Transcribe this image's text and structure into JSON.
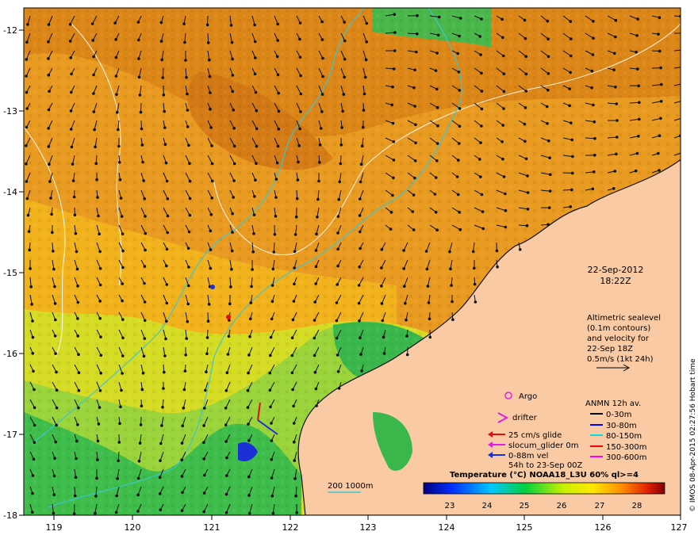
{
  "map": {
    "lon_ticks": [
      "119",
      "120",
      "121",
      "122",
      "123",
      "124",
      "125",
      "126",
      "127"
    ],
    "lat_ticks": [
      "-12",
      "-13",
      "-14",
      "-15",
      "-16",
      "-17",
      "-18"
    ],
    "lon_range": [
      118.6,
      127.0
    ],
    "lat_range": [
      -18.0,
      -11.7
    ]
  },
  "datetime": {
    "date": "22-Sep-2012",
    "time": "18:22Z"
  },
  "altimetry_note": [
    "Altimetric sealevel",
    "(0.1m contours)",
    "and velocity for",
    "22-Sep 18Z",
    "0.5m/s (1kt 24h)"
  ],
  "legend": {
    "argo": "Argo",
    "drifter": "drifter",
    "glider_speed": "25 cm/s glide",
    "slocum_glider": "slocum_glider 0m",
    "vel_line1": "0-88m vel",
    "vel_line2": "54h to 23-Sep 00Z",
    "anmn_title": "ANMN 12h av.",
    "anmn_depths": [
      {
        "label": "0-30m",
        "color": "#000000"
      },
      {
        "label": "30-80m",
        "color": "#0000ff"
      },
      {
        "label": "80-150m",
        "color": "#00e0e0"
      },
      {
        "label": "150-300m",
        "color": "#ff0000"
      },
      {
        "label": "300-600m",
        "color": "#ff00ff"
      }
    ]
  },
  "colorbar": {
    "title": "Temperature (°C) NOAA18_L3U 60% ql>=4",
    "ticks": [
      "23",
      "24",
      "25",
      "26",
      "27",
      "28"
    ],
    "range": [
      22.3,
      28.8
    ]
  },
  "isobath_label": "200  1000m",
  "credit": "© IMOS 08-Apr-2015 02:27:56 Hobart time",
  "colors": {
    "land": "#f9caa4",
    "warm": "#e8961e",
    "mid": "#f2b81a",
    "cool": "#8fd63a",
    "cold": "#2db55a",
    "isobath": "#3cc6d4"
  }
}
